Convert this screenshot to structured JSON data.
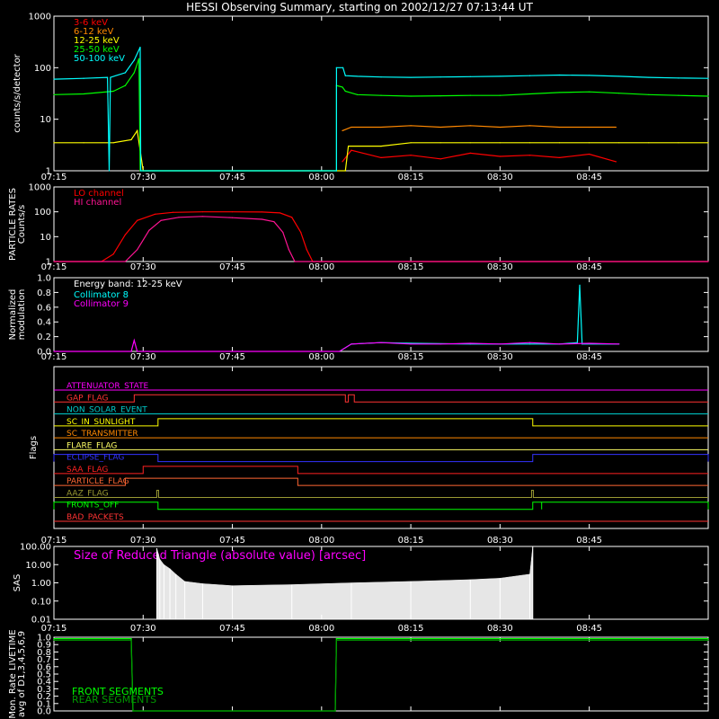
{
  "title": "HESSI Observing Summary, starting on 2002/12/27 07:13:44 UT",
  "time_ticks": [
    "07:15",
    "07:30",
    "07:45",
    "08:00",
    "08:15",
    "08:30",
    "08:45"
  ],
  "colors": {
    "bg": "#000000",
    "axis": "#ffffff",
    "e3_6": "#ff0000",
    "e6_12": "#ff8800",
    "e12_25": "#ffff00",
    "e25_50": "#00ff00",
    "e50_100": "#00ffff",
    "lo": "#ff0000",
    "hi": "#ff1493",
    "coll8": "#00ffff",
    "coll9": "#ff00ff",
    "front": "#00ff00",
    "rear": "#009900",
    "sas": "#ffffff",
    "sas_title": "#ff00ff"
  },
  "chart_data": [
    {
      "id": "counts",
      "type": "line",
      "ylabel": "counts/s/detector",
      "yscale": "log",
      "ylim": [
        1,
        1000
      ],
      "yticks": [
        "1",
        "10",
        "100",
        "1000"
      ],
      "x_unit": "minutes after 07:15",
      "legend_position": "top-left",
      "series": [
        {
          "name": "3-6 keV",
          "color_key": "e3_6",
          "points": [
            [
              48.5,
              1.5
            ],
            [
              50,
              2.5
            ],
            [
              55,
              1.8
            ],
            [
              60,
              2.0
            ],
            [
              65,
              1.7
            ],
            [
              70,
              2.2
            ],
            [
              75,
              1.9
            ],
            [
              80,
              2.0
            ],
            [
              85,
              1.8
            ],
            [
              90,
              2.1
            ],
            [
              94.5,
              1.5
            ]
          ]
        },
        {
          "name": "6-12 keV",
          "color_key": "e6_12",
          "points": [
            [
              48.5,
              6
            ],
            [
              50,
              7
            ],
            [
              55,
              7
            ],
            [
              60,
              7.5
            ],
            [
              65,
              7
            ],
            [
              70,
              7.5
            ],
            [
              75,
              7
            ],
            [
              80,
              7.5
            ],
            [
              85,
              7
            ],
            [
              90,
              7
            ],
            [
              94.5,
              7
            ]
          ]
        },
        {
          "name": "12-25 keV",
          "color_key": "e12_25",
          "points": [
            [
              0,
              3.5
            ],
            [
              5,
              3.5
            ],
            [
              10,
              3.5
            ],
            [
              13,
              4
            ],
            [
              14,
              6
            ],
            [
              15,
              1
            ],
            [
              49,
              1
            ],
            [
              49.5,
              3
            ],
            [
              55,
              3
            ],
            [
              60,
              3.5
            ],
            [
              65,
              3.5
            ],
            [
              70,
              3.5
            ],
            [
              75,
              3.5
            ],
            [
              80,
              3.5
            ],
            [
              85,
              3.5
            ],
            [
              90,
              3.5
            ],
            [
              95,
              3.5
            ],
            [
              100,
              3.5
            ],
            [
              105,
              3.5
            ],
            [
              110,
              3.5
            ]
          ]
        },
        {
          "name": "25-50 keV",
          "color_key": "e25_50",
          "points": [
            [
              0,
              30
            ],
            [
              5,
              31
            ],
            [
              10,
              35
            ],
            [
              12,
              45
            ],
            [
              13.5,
              80
            ],
            [
              14.3,
              150
            ],
            [
              14.5,
              1
            ],
            [
              47.5,
              1
            ],
            [
              47.5,
              45
            ],
            [
              48.5,
              42
            ],
            [
              49,
              35
            ],
            [
              51,
              30
            ],
            [
              55,
              29
            ],
            [
              60,
              28
            ],
            [
              65,
              28.5
            ],
            [
              70,
              29
            ],
            [
              75,
              29
            ],
            [
              80,
              31
            ],
            [
              85,
              33
            ],
            [
              90,
              34
            ],
            [
              95,
              32
            ],
            [
              100,
              30
            ],
            [
              105,
              29
            ],
            [
              110,
              28
            ]
          ]
        },
        {
          "name": "50-100 keV",
          "color_key": "e50_100",
          "points": [
            [
              0,
              60
            ],
            [
              5,
              62
            ],
            [
              9,
              65
            ],
            [
              9.3,
              1
            ],
            [
              9.5,
              65
            ],
            [
              12,
              80
            ],
            [
              13.5,
              140
            ],
            [
              14.5,
              250
            ],
            [
              14.6,
              1
            ],
            [
              47.5,
              1
            ],
            [
              47.5,
              100
            ],
            [
              48.6,
              100
            ],
            [
              49,
              70
            ],
            [
              51,
              68
            ],
            [
              55,
              66
            ],
            [
              60,
              65
            ],
            [
              65,
              66
            ],
            [
              70,
              67
            ],
            [
              75,
              68
            ],
            [
              80,
              70
            ],
            [
              85,
              72
            ],
            [
              90,
              71
            ],
            [
              95,
              68
            ],
            [
              100,
              65
            ],
            [
              105,
              63
            ],
            [
              110,
              62
            ]
          ]
        }
      ]
    },
    {
      "id": "particle",
      "type": "line",
      "ylabel": "PARTICLE RATES Counts/s",
      "yscale": "log",
      "ylim": [
        1,
        1000
      ],
      "yticks": [
        "1",
        "10",
        "100",
        "1000"
      ],
      "x_unit": "minutes after 07:15",
      "legend_position": "top-left",
      "series": [
        {
          "name": "LO channel",
          "color_key": "lo",
          "points": [
            [
              0,
              1
            ],
            [
              8,
              1
            ],
            [
              10,
              2
            ],
            [
              12,
              12
            ],
            [
              14,
              45
            ],
            [
              17,
              80
            ],
            [
              20,
              95
            ],
            [
              25,
              100
            ],
            [
              30,
              100
            ],
            [
              35,
              98
            ],
            [
              38,
              90
            ],
            [
              40,
              60
            ],
            [
              41.5,
              15
            ],
            [
              42.5,
              3
            ],
            [
              43.5,
              1
            ],
            [
              110,
              1
            ]
          ]
        },
        {
          "name": "HI channel",
          "color_key": "hi",
          "points": [
            [
              0,
              1
            ],
            [
              12,
              1
            ],
            [
              14,
              3
            ],
            [
              16,
              18
            ],
            [
              18,
              45
            ],
            [
              21,
              60
            ],
            [
              25,
              65
            ],
            [
              30,
              58
            ],
            [
              35,
              50
            ],
            [
              37,
              40
            ],
            [
              38.5,
              15
            ],
            [
              39.5,
              3
            ],
            [
              40.5,
              1
            ],
            [
              110,
              1
            ]
          ]
        }
      ]
    },
    {
      "id": "modulation",
      "type": "line",
      "ylabel": "Normalized modulation",
      "annotation": "Energy band: 12-25 keV",
      "yscale": "linear",
      "ylim": [
        0,
        1
      ],
      "yticks": [
        "0.0",
        "0.2",
        "0.4",
        "0.6",
        "0.8",
        "1.0"
      ],
      "x_unit": "minutes after 07:15",
      "legend_position": "top-left",
      "series": [
        {
          "name": "Collimator 8",
          "color_key": "coll8",
          "points": [
            [
              48,
              0.0
            ],
            [
              50,
              0.1
            ],
            [
              55,
              0.12
            ],
            [
              60,
              0.11
            ],
            [
              70,
              0.1
            ],
            [
              80,
              0.1
            ],
            [
              85,
              0.1
            ],
            [
              88,
              0.12
            ],
            [
              88.4,
              0.9
            ],
            [
              88.8,
              0.1
            ],
            [
              95,
              0.1
            ]
          ]
        },
        {
          "name": "Collimator 9",
          "color_key": "coll9",
          "points": [
            [
              0,
              0.0
            ],
            [
              13,
              0.0
            ],
            [
              13.5,
              0.15
            ],
            [
              14,
              0.0
            ],
            [
              48,
              0.0
            ],
            [
              50,
              0.1
            ],
            [
              55,
              0.12
            ],
            [
              60,
              0.1
            ],
            [
              65,
              0.1
            ],
            [
              70,
              0.11
            ],
            [
              75,
              0.1
            ],
            [
              80,
              0.12
            ],
            [
              85,
              0.1
            ],
            [
              90,
              0.11
            ],
            [
              95,
              0.1
            ]
          ]
        }
      ]
    },
    {
      "id": "flags",
      "type": "line",
      "ylabel": "Flags",
      "x_unit": "minutes after 07:15",
      "legend_position": "top-left",
      "series": [
        {
          "name": "ATTENUATOR_STATE",
          "color_key": "coll9",
          "segments": []
        },
        {
          "name": "GAP_FLAG",
          "color": "#ff3333",
          "segments": [
            [
              13.5,
              49
            ],
            [
              49.5,
              50.5
            ]
          ]
        },
        {
          "name": "NON_SOLAR_EVENT",
          "color": "#00cccc",
          "segments": []
        },
        {
          "name": "SC_IN_SUNLIGHT",
          "color": "#ffff00",
          "segments": [
            [
              17.5,
              80.5
            ]
          ]
        },
        {
          "name": "SC_TRANSMITTER",
          "color": "#ff8800",
          "segments": []
        },
        {
          "name": "FLARE_FLAG",
          "color": "#ffff66",
          "segments": []
        },
        {
          "name": "ECLIPSE_FLAG",
          "color": "#3333ff",
          "segments": [
            [
              0,
              17.5
            ],
            [
              80.5,
              110
            ]
          ]
        },
        {
          "name": "SAA_FLAG",
          "color": "#ff2222",
          "segments": [
            [
              15,
              41
            ]
          ]
        },
        {
          "name": "PARTICLE_FLAG",
          "color": "#ff6633",
          "segments": [
            [
              12,
              41
            ]
          ]
        },
        {
          "name": "AAZ_FLAG",
          "color": "#999933",
          "segments": [
            [
              17.3,
              17.6
            ],
            [
              80.3,
              80.6
            ]
          ]
        },
        {
          "name": "FRONTS_OFF",
          "color": "#00ff00",
          "segments": [
            [
              0,
              17.5
            ],
            [
              80.5,
              82
            ],
            [
              82,
              110
            ]
          ]
        },
        {
          "name": "BAD_PACKETS",
          "color": "#ff3333",
          "segments": []
        }
      ]
    },
    {
      "id": "sas",
      "type": "area",
      "ylabel": "SAS",
      "title": "Size of Reduced Triangle (absolute value) [arcsec]",
      "yscale": "log",
      "ylim": [
        0.01,
        100
      ],
      "yticks": [
        "0.01",
        "0.10",
        "1.00",
        "10.00",
        "100.00"
      ],
      "x_unit": "minutes after 07:15",
      "x": [
        17.3,
        17.8,
        18.5,
        19.5,
        20.5,
        22,
        25,
        30,
        40,
        50,
        60,
        70,
        75,
        80,
        80.5
      ],
      "values": [
        80,
        20,
        10,
        6,
        3,
        1.2,
        0.9,
        0.7,
        0.8,
        1.0,
        1.2,
        1.5,
        1.8,
        3,
        100
      ]
    },
    {
      "id": "livetime",
      "type": "line",
      "ylabel": "Mon. Rate LIVETIME avg of D1,3,4,5,6,9",
      "yscale": "linear",
      "ylim": [
        0,
        1.0
      ],
      "yticks": [
        "0.0",
        "0.1",
        "0.2",
        "0.3",
        "0.4",
        "0.5",
        "0.6",
        "0.7",
        "0.8",
        "0.9",
        "1.0"
      ],
      "x_unit": "minutes after 07:15",
      "legend_position": "bottom-left",
      "series": [
        {
          "name": "FRONT SEGMENTS",
          "color_key": "front",
          "points": [
            [
              0,
              0.98
            ],
            [
              13,
              0.98
            ],
            [
              13.3,
              0.0
            ],
            [
              47.3,
              0.0
            ],
            [
              47.5,
              0.98
            ],
            [
              110,
              0.98
            ]
          ]
        },
        {
          "name": "REAR SEGMENTS",
          "color_key": "rear",
          "points": [
            [
              0,
              0.96
            ],
            [
              13,
              0.96
            ],
            [
              13.3,
              0.0
            ],
            [
              47.3,
              0.0
            ],
            [
              47.5,
              0.96
            ],
            [
              110,
              0.96
            ]
          ]
        }
      ]
    }
  ]
}
